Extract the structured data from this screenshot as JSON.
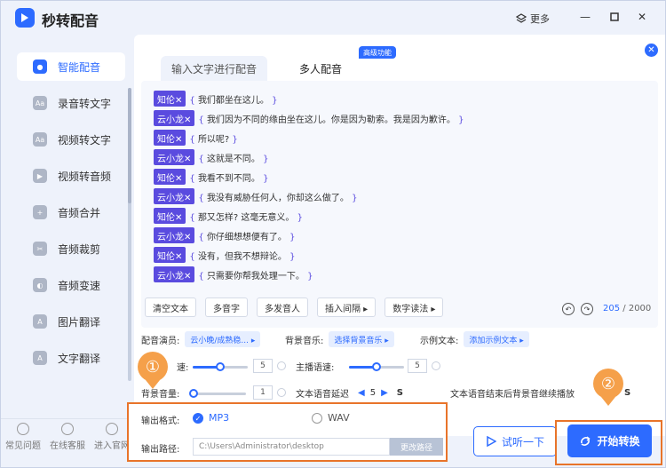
{
  "app": {
    "title": "秒转配音",
    "more_label": "更多"
  },
  "sidebar": {
    "items": [
      {
        "label": "智能配音",
        "icon": "mic-icon",
        "active": true
      },
      {
        "label": "录音转文字",
        "icon": "record-icon"
      },
      {
        "label": "视频转文字",
        "icon": "video-text-icon"
      },
      {
        "label": "视频转音频",
        "icon": "video-audio-icon"
      },
      {
        "label": "音频合并",
        "icon": "merge-icon"
      },
      {
        "label": "音频裁剪",
        "icon": "scissors-icon"
      },
      {
        "label": "音频变速",
        "icon": "speed-icon"
      },
      {
        "label": "图片翻译",
        "icon": "image-translate-icon"
      },
      {
        "label": "文字翻译",
        "icon": "text-translate-icon"
      }
    ],
    "bottom": [
      {
        "label": "常见问题",
        "icon": "question-icon"
      },
      {
        "label": "在线客服",
        "icon": "chat-icon"
      },
      {
        "label": "进入官网",
        "icon": "home-icon"
      }
    ]
  },
  "tabs": [
    {
      "label": "输入文字进行配音"
    },
    {
      "label": "多人配音"
    }
  ],
  "tab_badge": "高级功能",
  "dialogue": [
    {
      "speaker": "知伦✕",
      "text": "我们都坐在这儿。"
    },
    {
      "speaker": "云小龙✕",
      "text": "我们因为不同的缘由坐在这儿。你是因为勒索。我是因为歉许。"
    },
    {
      "speaker": "知伦✕",
      "text": "所以呢?"
    },
    {
      "speaker": "云小龙✕",
      "text": "这就是不同。"
    },
    {
      "speaker": "知伦✕",
      "text": "我看不到不同。"
    },
    {
      "speaker": "云小龙✕",
      "text": "我没有威胁任何人，你却这么做了。"
    },
    {
      "speaker": "知伦✕",
      "text": "那又怎样? 这毫无意义。"
    },
    {
      "speaker": "云小龙✕",
      "text": "你仔细想想便有了。"
    },
    {
      "speaker": "知伦✕",
      "text": "没有，但我不想辩论。"
    },
    {
      "speaker": "云小龙✕",
      "text": "只需要你帮我处理一下。"
    }
  ],
  "toolbar": {
    "clear": "清空文本",
    "polyphone": "多音字",
    "multi_speaker": "多发音人",
    "pause": "插入间隔 ▸",
    "number": "数字读法 ▸"
  },
  "counter": {
    "current": "205",
    "max": "/ 2000"
  },
  "options": {
    "voice_label": "配音演员:",
    "voice_value": "云小晚/成熟稳... ▸",
    "bgm_label": "背景音乐:",
    "bgm_value": "选择背景音乐 ▸",
    "sample_label": "示例文本:",
    "sample_value": "添加示例文本 ▸",
    "speed_label": "速:",
    "speed_value": "5",
    "main_speed_label": "主播语速:",
    "main_speed_value": "5",
    "bg_vol_label": "背景音量:",
    "bg_vol_value": "1",
    "delay_label": "文本语音延迟",
    "delay_value": "5",
    "delay_unit": "S",
    "continue_label": "文本语音结束后背景音继续播放",
    "continue_unit": "S",
    "speed_level": 0.5,
    "main_speed_level": 0.5,
    "bg_vol_level": 0.05
  },
  "output": {
    "format_label": "输出格式:",
    "mp3": "MP3",
    "wav": "WAV",
    "path_label": "输出路径:",
    "path_value": "C:\\Users\\Administrator\\desktop",
    "change_path": "更改路径"
  },
  "actions": {
    "trial": "试听一下",
    "start": "开始转换"
  },
  "markers": {
    "one": "①",
    "two": "②"
  },
  "colors": {
    "accent": "#2d6bff",
    "speaker": "#5a4bdf",
    "highlight": "#e8742a",
    "marker": "#f5a04a"
  }
}
